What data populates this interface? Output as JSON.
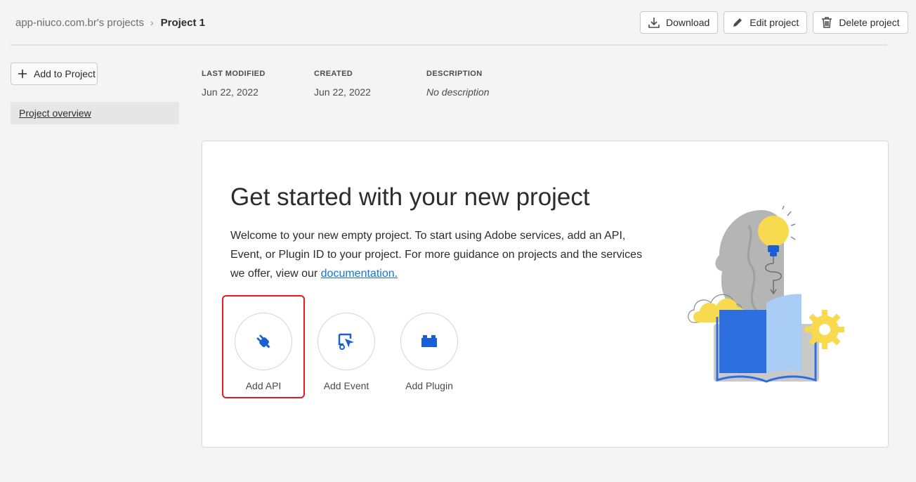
{
  "breadcrumb": {
    "parent": "app-niuco.com.br's projects",
    "separator": "›",
    "current": "Project 1"
  },
  "actions": {
    "download": "Download",
    "edit": "Edit project",
    "delete": "Delete project"
  },
  "sidebar": {
    "add_to_project": "Add to Project",
    "overview": "Project overview"
  },
  "meta": {
    "last_modified_label": "LAST MODIFIED",
    "last_modified_value": "Jun 22, 2022",
    "created_label": "CREATED",
    "created_value": "Jun 22, 2022",
    "description_label": "DESCRIPTION",
    "description_value": "No description"
  },
  "card": {
    "title": "Get started with your new project",
    "description": "Welcome to your new empty project. To start using Adobe services, add an API, Event, or Plugin ID to your project. For more guidance on projects and the services we offer, view our ",
    "link": "documentation."
  },
  "tiles": [
    {
      "label": "Add API",
      "icon": "plug-icon"
    },
    {
      "label": "Add Event",
      "icon": "event-icon"
    },
    {
      "label": "Add Plugin",
      "icon": "plugin-icon"
    }
  ],
  "colors": {
    "accent": "#1473e6",
    "icon_blue": "#1a5fd6",
    "highlight": "#e21b23",
    "background": "#f4f4f4"
  }
}
